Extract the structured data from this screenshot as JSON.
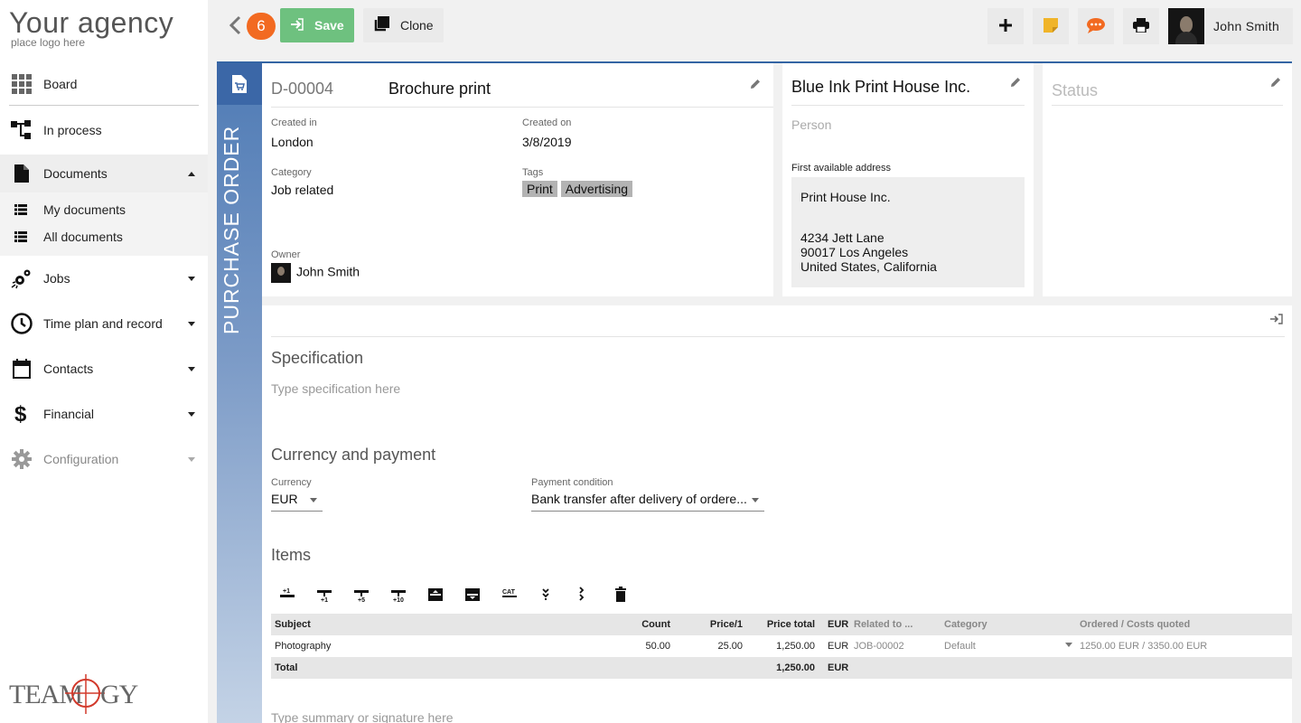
{
  "logo": {
    "title": "Your agency",
    "subtitle": "place logo here"
  },
  "sidebar": {
    "items": [
      {
        "label": "Board",
        "icon": "grid-icon"
      },
      {
        "label": "In process",
        "icon": "workflow-icon"
      },
      {
        "label": "Documents",
        "icon": "document-icon",
        "expanded": true
      },
      {
        "label": "Jobs",
        "icon": "jobs-icon"
      },
      {
        "label": "Time plan and record",
        "icon": "clock-icon"
      },
      {
        "label": "Contacts",
        "icon": "calendar-icon"
      },
      {
        "label": "Financial",
        "icon": "dollar-icon"
      },
      {
        "label": "Configuration",
        "icon": "gear-icon"
      }
    ],
    "sub_items": [
      {
        "label": "My documents",
        "icon": "list-icon"
      },
      {
        "label": "All documents",
        "icon": "list-icon"
      }
    ],
    "brand": "TEAMOGY"
  },
  "topbar": {
    "badge_count": "6",
    "save_label": "Save",
    "clone_label": "Clone",
    "user_name": "John Smith"
  },
  "document": {
    "type_label": "PURCHASE ORDER",
    "number": "D-00004",
    "title": "Brochure print",
    "created_in_label": "Created in",
    "created_in": "London",
    "created_on_label": "Created on",
    "created_on": "3/8/2019",
    "category_label": "Category",
    "category": "Job related",
    "tags_label": "Tags",
    "tags": [
      "Print",
      "Advertising"
    ],
    "owner_label": "Owner",
    "owner": "John Smith"
  },
  "company": {
    "name": "Blue Ink Print House Inc.",
    "person_placeholder": "Person",
    "address_label": "First available address",
    "address_line1": "Print House Inc.",
    "address_line2": "4234  Jett Lane",
    "address_line3": "90017 Los Angeles",
    "address_line4": "United States, California"
  },
  "status": {
    "placeholder": "Status"
  },
  "specification": {
    "title": "Specification",
    "placeholder": "Type specification here"
  },
  "payment": {
    "title": "Currency and payment",
    "currency_label": "Currency",
    "currency": "EUR",
    "condition_label": "Payment condition",
    "condition": "Bank transfer after delivery of ordere..."
  },
  "items": {
    "title": "Items",
    "toolbar": [
      {
        "icon": "add-row-icon"
      },
      {
        "icon": "add-one-icon"
      },
      {
        "icon": "add-five-icon"
      },
      {
        "icon": "add-ten-icon"
      },
      {
        "icon": "insert-above-icon"
      },
      {
        "icon": "insert-below-icon"
      },
      {
        "icon": "catalog-icon"
      },
      {
        "icon": "expand-icon"
      },
      {
        "icon": "more-icon"
      },
      {
        "icon": "trash-icon"
      }
    ],
    "columns": [
      "Subject",
      "Count",
      "Price/1",
      "Price total",
      "EUR",
      "Related to ...",
      "Category",
      "Ordered / Costs quoted"
    ],
    "rows": [
      {
        "subject": "Photography",
        "count": "50.00",
        "price": "25.00",
        "total": "1,250.00",
        "currency": "EUR",
        "related": "JOB-00002",
        "category": "Default",
        "ordered": "1250.00 EUR / 3350.00 EUR"
      }
    ],
    "total_label": "Total",
    "total_value": "1,250.00",
    "total_currency": "EUR"
  },
  "summary": {
    "placeholder": "Type summary or signature here"
  }
}
